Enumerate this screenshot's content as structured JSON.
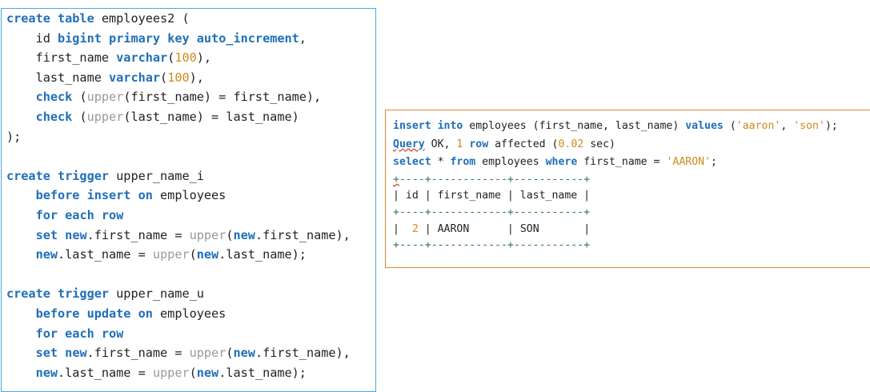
{
  "sql_editor": {
    "lines": [
      [
        {
          "t": "create table",
          "k": "kw"
        },
        {
          "t": " employees2 ("
        }
      ],
      [
        {
          "t": "    id "
        },
        {
          "t": "bigint",
          "k": "kw"
        },
        {
          "t": " "
        },
        {
          "t": "primary key auto_increment",
          "k": "kw"
        },
        {
          "t": ","
        }
      ],
      [
        {
          "t": "    first_name "
        },
        {
          "t": "varchar",
          "k": "kw"
        },
        {
          "t": "("
        },
        {
          "t": "100",
          "k": "num"
        },
        {
          "t": "),"
        }
      ],
      [
        {
          "t": "    last_name "
        },
        {
          "t": "varchar",
          "k": "kw"
        },
        {
          "t": "("
        },
        {
          "t": "100",
          "k": "num"
        },
        {
          "t": "),"
        }
      ],
      [
        {
          "t": "    "
        },
        {
          "t": "check",
          "k": "kw"
        },
        {
          "t": " ("
        },
        {
          "t": "upper",
          "k": "fn"
        },
        {
          "t": "(first_name) = first_name),"
        }
      ],
      [
        {
          "t": "    "
        },
        {
          "t": "check",
          "k": "kw"
        },
        {
          "t": " ("
        },
        {
          "t": "upper",
          "k": "fn"
        },
        {
          "t": "(last_name) = last_name)"
        }
      ],
      [
        {
          "t": ");"
        }
      ],
      [],
      [
        {
          "t": "create trigger",
          "k": "kw"
        },
        {
          "t": " upper_name_i"
        }
      ],
      [
        {
          "t": "    "
        },
        {
          "t": "before insert on",
          "k": "kw"
        },
        {
          "t": " employees"
        }
      ],
      [
        {
          "t": "    "
        },
        {
          "t": "for each row",
          "k": "kw"
        }
      ],
      [
        {
          "t": "    "
        },
        {
          "t": "set",
          "k": "kw"
        },
        {
          "t": " "
        },
        {
          "t": "new",
          "k": "kw"
        },
        {
          "t": ".first_name = "
        },
        {
          "t": "upper",
          "k": "fn"
        },
        {
          "t": "("
        },
        {
          "t": "new",
          "k": "kw"
        },
        {
          "t": ".first_name),"
        }
      ],
      [
        {
          "t": "    "
        },
        {
          "t": "new",
          "k": "kw"
        },
        {
          "t": ".last_name = "
        },
        {
          "t": "upper",
          "k": "fn"
        },
        {
          "t": "("
        },
        {
          "t": "new",
          "k": "kw"
        },
        {
          "t": ".last_name);"
        }
      ],
      [],
      [
        {
          "t": "create trigger",
          "k": "kw"
        },
        {
          "t": " upper_name_u"
        }
      ],
      [
        {
          "t": "    "
        },
        {
          "t": "before update on",
          "k": "kw"
        },
        {
          "t": " employees"
        }
      ],
      [
        {
          "t": "    "
        },
        {
          "t": "for each row",
          "k": "kw"
        }
      ],
      [
        {
          "t": "    "
        },
        {
          "t": "set",
          "k": "kw"
        },
        {
          "t": " "
        },
        {
          "t": "new",
          "k": "kw"
        },
        {
          "t": ".first_name = "
        },
        {
          "t": "upper",
          "k": "fn"
        },
        {
          "t": "("
        },
        {
          "t": "new",
          "k": "kw"
        },
        {
          "t": ".first_name),"
        }
      ],
      [
        {
          "t": "    "
        },
        {
          "t": "new",
          "k": "kw"
        },
        {
          "t": ".last_name = "
        },
        {
          "t": "upper",
          "k": "fn"
        },
        {
          "t": "("
        },
        {
          "t": "new",
          "k": "kw"
        },
        {
          "t": ".last_name);"
        }
      ]
    ]
  },
  "console": {
    "lines": [
      [
        {
          "t": "insert into",
          "k": "kw"
        },
        {
          "t": " employees (first_name, last_name) "
        },
        {
          "t": "values",
          "k": "kw"
        },
        {
          "t": " ("
        },
        {
          "t": "'aaron'",
          "k": "str"
        },
        {
          "t": ", "
        },
        {
          "t": "'son'",
          "k": "str"
        },
        {
          "t": ");"
        }
      ],
      [
        {
          "t": "Query",
          "k": "kw sq"
        },
        {
          "t": " OK, "
        },
        {
          "t": "1",
          "k": "num"
        },
        {
          "t": " "
        },
        {
          "t": "row",
          "k": "kw"
        },
        {
          "t": " affected ("
        },
        {
          "t": "0.02",
          "k": "num"
        },
        {
          "t": " sec)"
        }
      ],
      [
        {
          "t": "select",
          "k": "kw"
        },
        {
          "t": " * "
        },
        {
          "t": "from",
          "k": "kw"
        },
        {
          "t": " employees "
        },
        {
          "t": "where",
          "k": "kw"
        },
        {
          "t": " first_name = "
        },
        {
          "t": "'AARON'",
          "k": "str"
        },
        {
          "t": ";"
        }
      ]
    ],
    "table_lines": [
      [
        {
          "t": "+",
          "k": "tb sq"
        },
        {
          "t": "----+------------+-----------+",
          "k": "tb"
        }
      ],
      [
        {
          "t": "| id | first_name | last_name |"
        }
      ],
      [
        {
          "t": "+----+------------+-----------+",
          "k": "tb"
        }
      ],
      [
        {
          "t": "|  "
        },
        {
          "t": "2",
          "k": "num"
        },
        {
          "t": " | AARON      | SON       |"
        }
      ],
      [
        {
          "t": "+----+------------+-----------+",
          "k": "tb"
        }
      ]
    ]
  }
}
